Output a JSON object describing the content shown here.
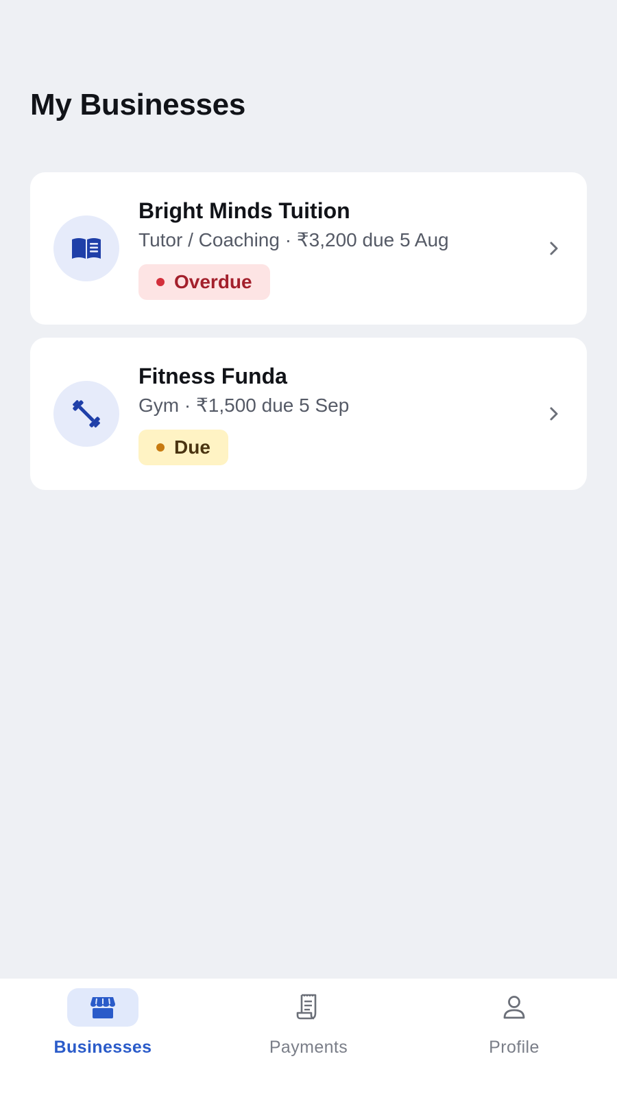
{
  "page": {
    "title": "My Businesses"
  },
  "businesses": [
    {
      "name": "Bright Minds Tuition",
      "meta": "Tutor / Coaching · ₹3,200 due 5 Aug",
      "status": "Overdue",
      "icon": "book-icon"
    },
    {
      "name": "Fitness Funda",
      "meta": "Gym · ₹1,500 due 5 Sep",
      "status": "Due",
      "icon": "dumbbell-icon"
    }
  ],
  "nav": {
    "items": [
      {
        "label": "Businesses",
        "icon": "storefront-icon",
        "active": true
      },
      {
        "label": "Payments",
        "icon": "receipt-icon",
        "active": false
      },
      {
        "label": "Profile",
        "icon": "person-icon",
        "active": false
      }
    ]
  },
  "colors": {
    "accent": "#2a5bc9",
    "icon_dark": "#1f3fa8",
    "overdue": "#d32f3b",
    "due": "#c77a10",
    "background": "#eef0f4"
  }
}
